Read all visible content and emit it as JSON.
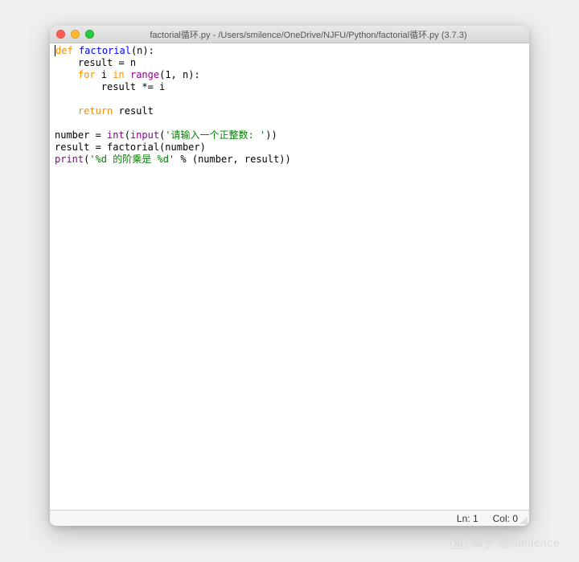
{
  "window": {
    "title": "factorial循环.py - /Users/smilence/OneDrive/NJFU/Python/factorial循环.py (3.7.3)"
  },
  "code": {
    "lines": [
      {
        "tokens": [
          {
            "t": "kw",
            "s": "def"
          },
          {
            "t": "",
            "s": " "
          },
          {
            "t": "def",
            "s": "factorial"
          },
          {
            "t": "",
            "s": "(n):"
          }
        ]
      },
      {
        "tokens": [
          {
            "t": "",
            "s": "    result = n"
          }
        ]
      },
      {
        "tokens": [
          {
            "t": "",
            "s": "    "
          },
          {
            "t": "kw",
            "s": "for"
          },
          {
            "t": "",
            "s": " i "
          },
          {
            "t": "kw",
            "s": "in"
          },
          {
            "t": "",
            "s": " "
          },
          {
            "t": "builtin",
            "s": "range"
          },
          {
            "t": "",
            "s": "(1, n):"
          }
        ]
      },
      {
        "tokens": [
          {
            "t": "",
            "s": "        result *= i"
          }
        ]
      },
      {
        "tokens": []
      },
      {
        "tokens": [
          {
            "t": "",
            "s": "    "
          },
          {
            "t": "kw",
            "s": "return"
          },
          {
            "t": "",
            "s": " result"
          }
        ]
      },
      {
        "tokens": []
      },
      {
        "tokens": [
          {
            "t": "",
            "s": "number = "
          },
          {
            "t": "builtin",
            "s": "int"
          },
          {
            "t": "",
            "s": "("
          },
          {
            "t": "builtin",
            "s": "input"
          },
          {
            "t": "",
            "s": "("
          },
          {
            "t": "str",
            "s": "'请输入一个正整数: '"
          },
          {
            "t": "",
            "s": "))"
          }
        ]
      },
      {
        "tokens": [
          {
            "t": "",
            "s": "result = factorial(number)"
          }
        ]
      },
      {
        "tokens": [
          {
            "t": "builtin",
            "s": "print"
          },
          {
            "t": "",
            "s": "("
          },
          {
            "t": "str",
            "s": "'%d 的阶乘是 %d'"
          },
          {
            "t": "",
            "s": " % (number, result))"
          }
        ]
      }
    ]
  },
  "status": {
    "ln_label": "Ln:",
    "ln_value": "1",
    "col_label": "Col:",
    "col_value": "0"
  },
  "watermark": {
    "text": "知乎 @Smilence"
  }
}
